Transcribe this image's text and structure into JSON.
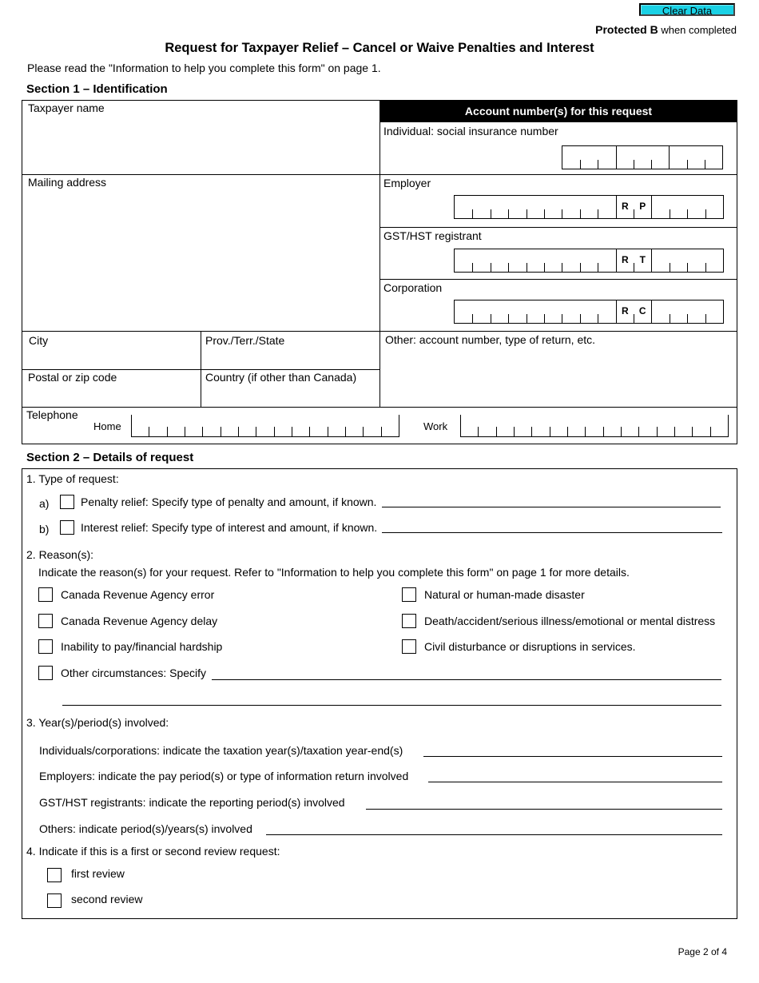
{
  "header": {
    "clear_button": "Clear Data",
    "protected_bold": "Protected B",
    "protected_rest": " when completed",
    "title": "Request for Taxpayer Relief – Cancel or Waive Penalties and Interest",
    "intro": "Please read the \"Information to help you complete this form\" on page 1."
  },
  "colors": {
    "clear_button_bg": "#1ad1e5",
    "header_bar": "#000000"
  },
  "section1": {
    "title": "Section 1 – Identification",
    "taxpayer_name": "Taxpayer name",
    "mailing_address": "Mailing address",
    "city": "City",
    "province": "Prov./Terr./State",
    "postal": "Postal or zip code",
    "country": "Country (if other than Canada)",
    "other": "Other: account number, type of return, etc.",
    "accounts": {
      "heading": "Account number(s) for this request",
      "sin": "Individual: social insurance number",
      "employer": "Employer",
      "employer_code": [
        "R",
        "P"
      ],
      "gst": "GST/HST registrant",
      "gst_code": [
        "R",
        "T"
      ],
      "corporation": "Corporation",
      "corporation_code": [
        "R",
        "C"
      ]
    },
    "telephone": {
      "label": "Telephone",
      "home": "Home",
      "work": "Work"
    }
  },
  "section2": {
    "title": "Section 2 – Details of request",
    "q1": {
      "label": "1. Type of request:",
      "items": [
        {
          "letter": "a)",
          "text": "Penalty relief: Specify type of penalty and amount, if known.",
          "checked": false
        },
        {
          "letter": "b)",
          "text": "Interest relief: Specify type of interest and amount, if known.",
          "checked": false
        }
      ]
    },
    "q2": {
      "label": "2. Reason(s):",
      "instruction": "Indicate the reason(s) for your request. Refer to \"Information to help you complete this form\" on page 1 for more details.",
      "left": [
        {
          "text": "Canada Revenue Agency error",
          "checked": false
        },
        {
          "text": "Canada Revenue Agency delay",
          "checked": false
        },
        {
          "text": "Inability to pay/financial hardship",
          "checked": false
        }
      ],
      "right": [
        {
          "text": "Natural or human-made disaster",
          "checked": false
        },
        {
          "text": "Death/accident/serious illness/emotional or mental distress",
          "checked": false
        },
        {
          "text": "Civil disturbance or disruptions in services.",
          "checked": false
        }
      ],
      "other": {
        "text": "Other circumstances: Specify",
        "checked": false
      }
    },
    "q3": {
      "label": "3. Year(s)/period(s) involved:",
      "items": [
        "Individuals/corporations: indicate the taxation year(s)/taxation year-end(s)",
        "Employers: indicate the pay period(s) or type of information return involved",
        "GST/HST registrants: indicate the reporting period(s) involved",
        "Others: indicate period(s)/years(s) involved"
      ]
    },
    "q4": {
      "label": "4. Indicate if this is a first or second review request:",
      "first": "first review",
      "second": "second review"
    }
  },
  "footer": {
    "page": "Page 2 of 4"
  }
}
